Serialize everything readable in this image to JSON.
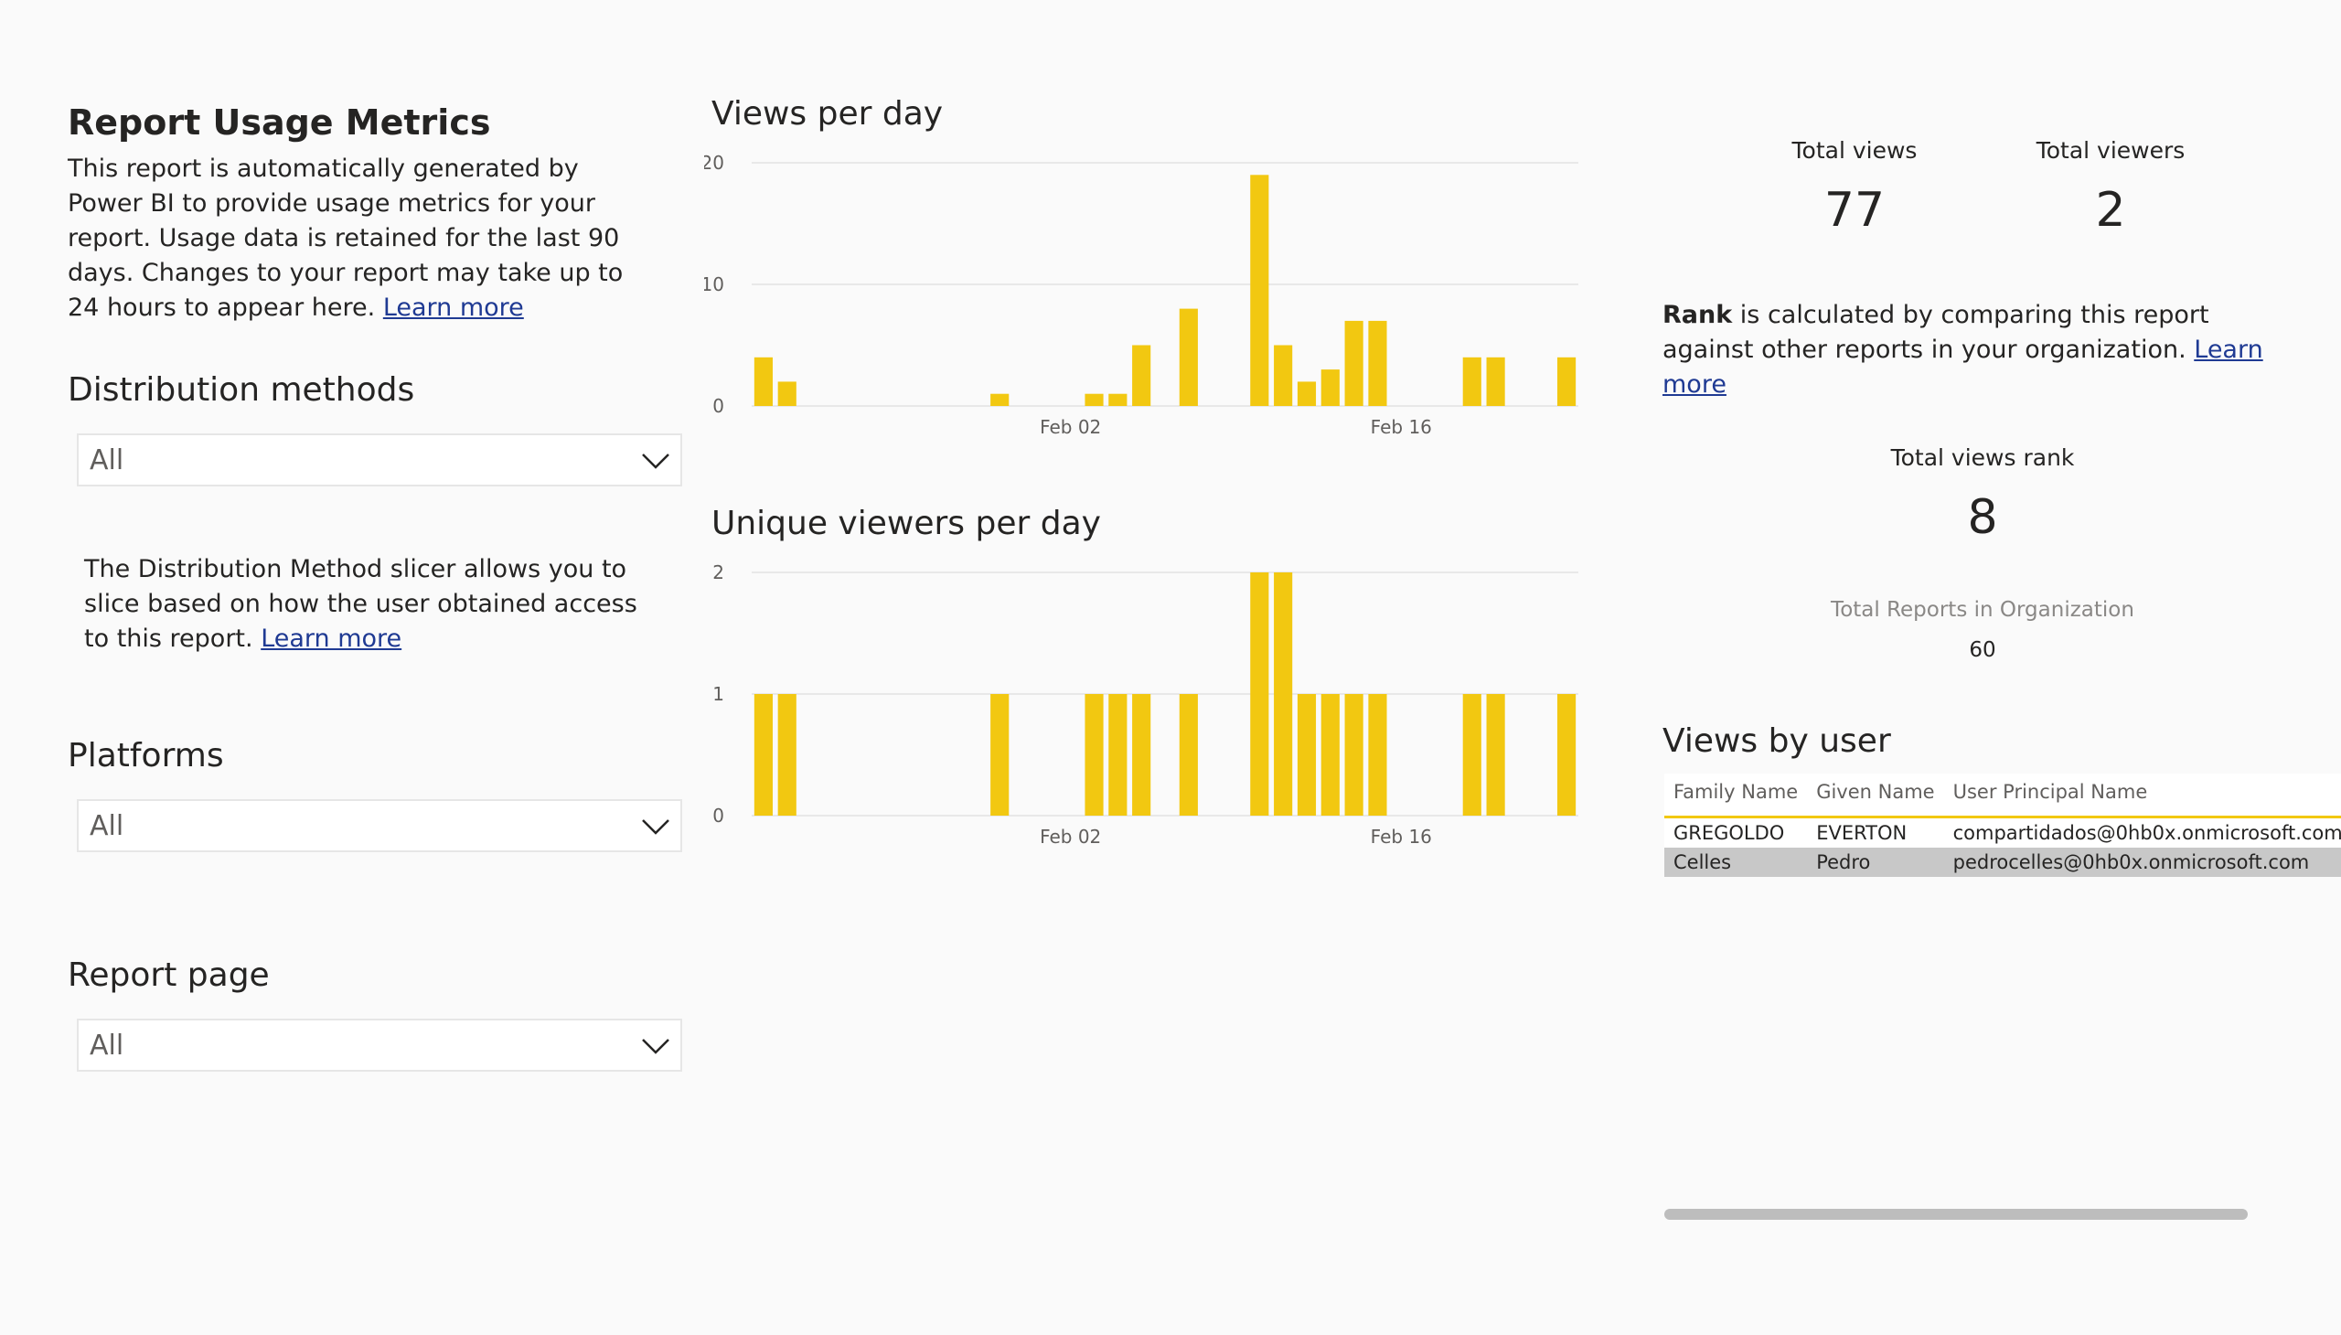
{
  "page": {
    "title": "Report Usage Metrics",
    "description": "This report is automatically generated by Power BI to provide usage metrics for your report. Usage data is retained for the last 90 days. Changes to your report may take up to 24 hours to appear here.",
    "learn_more": "Learn more"
  },
  "slicers": {
    "distribution": {
      "title": "Distribution methods",
      "value": "All"
    },
    "note": "The Distribution Method slicer allows you to slice based on how the user obtained access to this report.",
    "platforms": {
      "title": "Platforms",
      "value": "All"
    },
    "report_page": {
      "title": "Report page",
      "value": "All"
    }
  },
  "kpis": {
    "total_views_label": "Total views",
    "total_views": "77",
    "total_viewers_label": "Total viewers",
    "total_viewers": "2",
    "rank_word": "Rank",
    "rank_desc": "is calculated by comparing this report against other reports in your organization.",
    "total_views_rank_label": "Total views rank",
    "total_views_rank": "8",
    "total_reports_label": "Total Reports in Organization",
    "total_reports": "60"
  },
  "views_by_user": {
    "title": "Views by user",
    "columns": [
      "Family Name",
      "Given Name",
      "User Principal Name"
    ],
    "rows": [
      [
        "GREGOLDO",
        "EVERTON",
        "compartidados@0hb0x.onmicrosoft.com"
      ],
      [
        "Celles",
        "Pedro",
        "pedrocelles@0hb0x.onmicrosoft.com"
      ]
    ]
  },
  "colors": {
    "bar": "#f2c811",
    "gridline": "#e1e1e1"
  },
  "chart_data": [
    {
      "type": "bar",
      "title": "Views per day",
      "x_tick_labels": [
        "Feb 02",
        "Feb 16"
      ],
      "x_ticks_at": [
        "2025-02-02",
        "2025-02-16"
      ],
      "x": [
        "2025-01-20",
        "2025-01-21",
        "2025-01-22",
        "2025-01-23",
        "2025-01-24",
        "2025-01-25",
        "2025-01-26",
        "2025-01-27",
        "2025-01-28",
        "2025-01-29",
        "2025-01-30",
        "2025-01-31",
        "2025-02-01",
        "2025-02-02",
        "2025-02-03",
        "2025-02-04",
        "2025-02-05",
        "2025-02-06",
        "2025-02-07",
        "2025-02-08",
        "2025-02-09",
        "2025-02-10",
        "2025-02-11",
        "2025-02-12",
        "2025-02-13",
        "2025-02-14",
        "2025-02-15",
        "2025-02-16",
        "2025-02-17",
        "2025-02-18",
        "2025-02-19",
        "2025-02-20",
        "2025-02-21",
        "2025-02-22",
        "2025-02-23",
        "2025-02-24",
        "2025-02-25"
      ],
      "values": [
        4,
        2,
        0,
        0,
        0,
        0,
        0,
        0,
        0,
        0,
        1,
        0,
        0,
        0,
        1,
        1,
        5,
        0,
        8,
        0,
        0,
        19,
        5,
        2,
        3,
        7,
        7,
        0,
        0,
        0,
        4,
        4,
        0,
        0,
        4
      ],
      "y_ticks": [
        0,
        10,
        20
      ],
      "ylim": [
        0,
        20
      ],
      "grid": true
    },
    {
      "type": "bar",
      "title": "Unique viewers per day",
      "x_tick_labels": [
        "Feb 02",
        "Feb 16"
      ],
      "x_ticks_at": [
        "2025-02-02",
        "2025-02-16"
      ],
      "x": [
        "2025-01-20",
        "2025-01-21",
        "2025-01-22",
        "2025-01-23",
        "2025-01-24",
        "2025-01-25",
        "2025-01-26",
        "2025-01-27",
        "2025-01-28",
        "2025-01-29",
        "2025-01-30",
        "2025-01-31",
        "2025-02-01",
        "2025-02-02",
        "2025-02-03",
        "2025-02-04",
        "2025-02-05",
        "2025-02-06",
        "2025-02-07",
        "2025-02-08",
        "2025-02-09",
        "2025-02-10",
        "2025-02-11",
        "2025-02-12",
        "2025-02-13",
        "2025-02-14",
        "2025-02-15",
        "2025-02-16",
        "2025-02-17",
        "2025-02-18",
        "2025-02-19",
        "2025-02-20",
        "2025-02-21",
        "2025-02-22",
        "2025-02-23"
      ],
      "values": [
        1,
        1,
        0,
        0,
        0,
        0,
        0,
        0,
        0,
        0,
        1,
        0,
        0,
        0,
        1,
        1,
        1,
        0,
        1,
        0,
        0,
        2,
        2,
        1,
        1,
        1,
        1,
        0,
        0,
        0,
        1,
        1,
        0,
        0,
        1
      ],
      "y_ticks": [
        0,
        1,
        2
      ],
      "ylim": [
        0,
        2
      ],
      "grid": true
    }
  ]
}
